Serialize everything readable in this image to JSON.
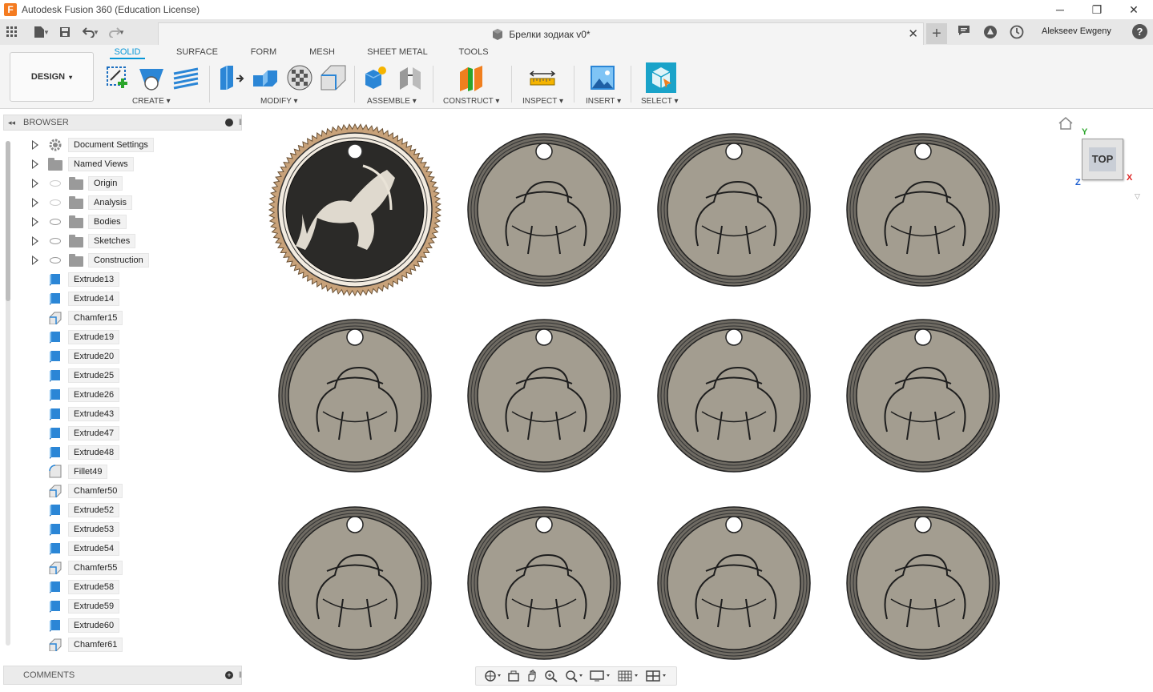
{
  "window": {
    "app_title": "Autodesk Fusion 360 (Education License)",
    "logo_letter": "F",
    "minimize": "─",
    "restore": "❐",
    "close": "✕"
  },
  "appbar": {
    "doc_title": "Брелки зодиак v0*",
    "close_tab": "✕",
    "new_tab": "+",
    "user_name": "Alekseev Ewgeny",
    "help": "?"
  },
  "toolbar": {
    "workspace": "DESIGN",
    "tabs": [
      "SOLID",
      "SURFACE",
      "FORM",
      "MESH",
      "SHEET METAL",
      "TOOLS"
    ],
    "groups": [
      "CREATE",
      "MODIFY",
      "ASSEMBLE",
      "CONSTRUCT",
      "INSPECT",
      "INSERT",
      "SELECT"
    ],
    "caret": "▾"
  },
  "browser": {
    "title": "BROWSER",
    "folders": [
      "Document Settings",
      "Named Views",
      "Origin",
      "Analysis",
      "Bodies",
      "Sketches",
      "Construction"
    ],
    "features": [
      "Extrude13",
      "Extrude14",
      "Chamfer15",
      "Extrude19",
      "Extrude20",
      "Extrude25",
      "Extrude26",
      "Extrude43",
      "Extrude47",
      "Extrude48",
      "Fillet49",
      "Chamfer50",
      "Extrude52",
      "Extrude53",
      "Extrude54",
      "Chamfer55",
      "Extrude58",
      "Extrude59",
      "Extrude60",
      "Chamfer61"
    ]
  },
  "comments": {
    "title": "COMMENTS"
  },
  "viewcube": {
    "face": "TOP",
    "axis_y": "Y",
    "axis_x": "X",
    "axis_z": "Z"
  },
  "colors": {
    "accent": "#0696d7",
    "coin_face": "#a39d90",
    "coin_ring": "#6f6b63",
    "first_coin_face": "#2b2a28",
    "first_coin_rim": "#c8a27a"
  }
}
